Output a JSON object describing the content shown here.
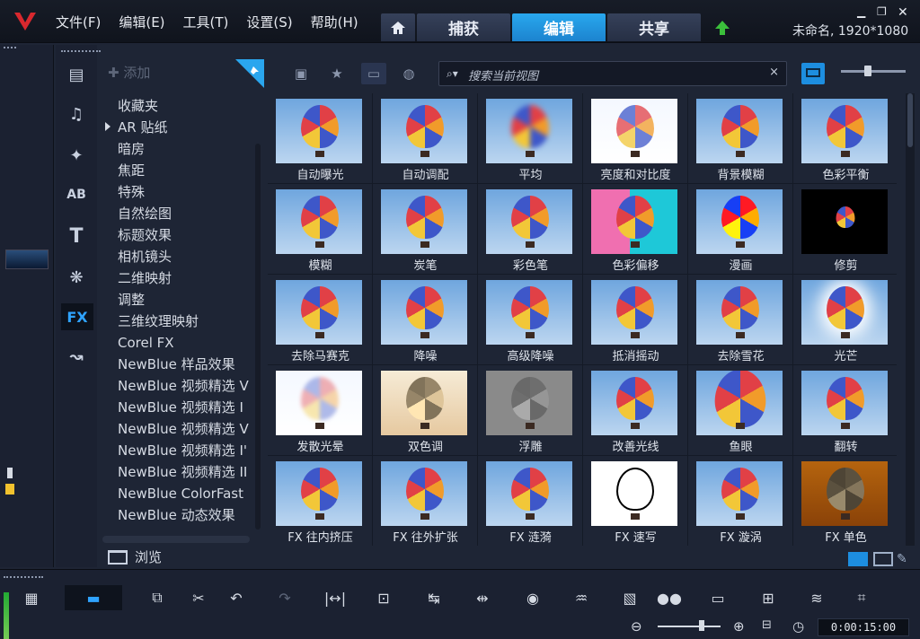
{
  "app": {
    "project_name": "未命名, 1920*1080",
    "menu": [
      "文件(F)",
      "编辑(E)",
      "工具(T)",
      "设置(S)",
      "帮助(H)"
    ],
    "tabs": [
      "捕获",
      "编辑",
      "共享"
    ],
    "active_tab": "编辑"
  },
  "library": {
    "add_label": "添加",
    "search_placeholder": "搜索当前视图",
    "browse_label": "浏览",
    "categories": [
      "收藏夹",
      "AR 贴纸",
      "暗房",
      "焦距",
      "特殊",
      "自然绘图",
      "标题效果",
      "相机镜头",
      "二维映射",
      "调整",
      "三维纹理映射",
      "Corel FX",
      "NewBlue 样品效果",
      "NewBlue 视频精选 V",
      "NewBlue 视频精选 I",
      "NewBlue 视频精选 V",
      "NewBlue 视频精选 I'",
      "NewBlue 视频精选 II",
      "NewBlue ColorFast",
      "NewBlue 动态效果"
    ],
    "category_icon_active": "FX",
    "filters": [
      {
        "label": "自动曝光",
        "style": "normal"
      },
      {
        "label": "自动调配",
        "style": "normal"
      },
      {
        "label": "平均",
        "style": "blur"
      },
      {
        "label": "亮度和对比度",
        "style": "bright"
      },
      {
        "label": "背景模糊",
        "style": "normal"
      },
      {
        "label": "色彩平衡",
        "style": "normal"
      },
      {
        "label": "模糊",
        "style": "normal"
      },
      {
        "label": "炭笔",
        "style": "normal"
      },
      {
        "label": "彩色笔",
        "style": "normal"
      },
      {
        "label": "色彩偏移",
        "style": "shift"
      },
      {
        "label": "漫画",
        "style": "comic"
      },
      {
        "label": "修剪",
        "style": "crop"
      },
      {
        "label": "去除马赛克",
        "style": "normal"
      },
      {
        "label": "降噪",
        "style": "normal"
      },
      {
        "label": "高级降噪",
        "style": "normal"
      },
      {
        "label": "抵消摇动",
        "style": "normal"
      },
      {
        "label": "去除雪花",
        "style": "normal"
      },
      {
        "label": "光芒",
        "style": "glow"
      },
      {
        "label": "发散光晕",
        "style": "haze"
      },
      {
        "label": "双色调",
        "style": "duotone"
      },
      {
        "label": "浮雕",
        "style": "emboss"
      },
      {
        "label": "改善光线",
        "style": "normal"
      },
      {
        "label": "鱼眼",
        "style": "fisheye"
      },
      {
        "label": "翻转",
        "style": "normal"
      },
      {
        "label": "FX 往内挤压",
        "style": "normal"
      },
      {
        "label": "FX 往外扩张",
        "style": "normal"
      },
      {
        "label": "FX 涟漪",
        "style": "normal"
      },
      {
        "label": "FX 速写",
        "style": "sketch"
      },
      {
        "label": "FX 漩涡",
        "style": "normal"
      },
      {
        "label": "FX 单色",
        "style": "mono"
      }
    ]
  },
  "timeline": {
    "timecode": "0:00:15:00"
  }
}
